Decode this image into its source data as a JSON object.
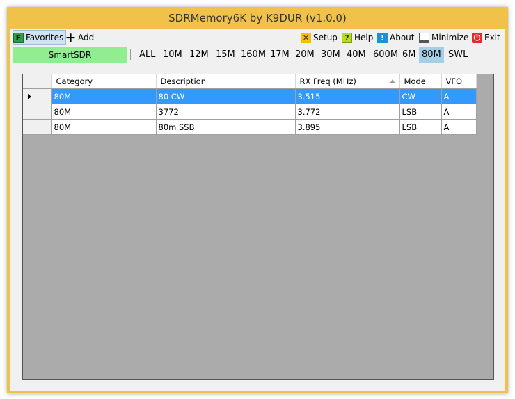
{
  "window": {
    "title": "SDRMemory6K by K9DUR (v1.0.0)"
  },
  "toolbar": {
    "favorites_icon": "F",
    "favorites_label": "Favorites",
    "add_icon": "+",
    "add_label": "Add",
    "setup_label": "Setup",
    "help_icon": "?",
    "help_label": "Help",
    "about_icon": "!",
    "about_label": "About",
    "minimize_label": "Minimize",
    "exit_icon": "⏻",
    "exit_label": "Exit"
  },
  "source_button": "SmartSDR",
  "bands": [
    "ALL",
    "10M",
    "12M",
    "15M",
    "160M",
    "17M",
    "20M",
    "30M",
    "40M",
    "600M",
    "6M",
    "80M",
    "SWL"
  ],
  "active_band": "80M",
  "table": {
    "columns": [
      "Category",
      "Description",
      "RX Freq (MHz)",
      "Mode",
      "VFO"
    ],
    "sort_column": "RX Freq (MHz)",
    "rows": [
      {
        "category": "80M",
        "description": "80 CW",
        "rx_freq": "3.515",
        "mode": "CW",
        "vfo": "A"
      },
      {
        "category": "80M",
        "description": "3772",
        "rx_freq": "3.772",
        "mode": "LSB",
        "vfo": "A"
      },
      {
        "category": "80M",
        "description": "80m SSB",
        "rx_freq": "3.895",
        "mode": "LSB",
        "vfo": "A"
      }
    ],
    "selected_row": 0
  },
  "colors": {
    "window_border": "#f0c24a",
    "selection": "#3399ff",
    "smartsdr": "#90ee90",
    "active_band": "#a5cfe6",
    "grid_background": "#ababab"
  }
}
